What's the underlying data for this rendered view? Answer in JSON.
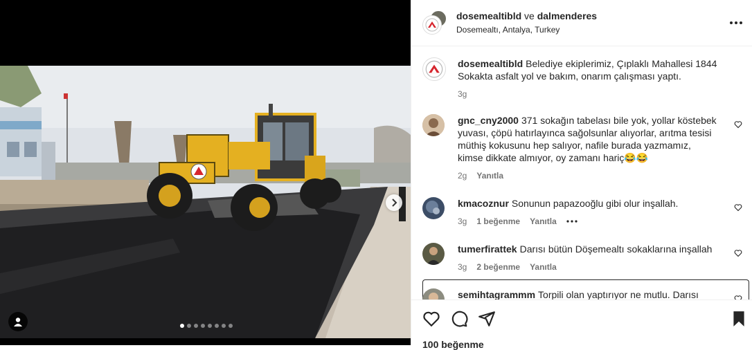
{
  "post": {
    "author": "dosemealtibld",
    "connector": "ve",
    "coauthor": "dalmenderes",
    "location": "Dosemealtı, Antalya, Turkey",
    "more_icon": "more-horizontal-icon"
  },
  "caption": {
    "user": "dosemealtibld",
    "text": "Belediye ekiplerimiz, Çıplaklı Mahallesi 1844 Sokakta asfalt yol ve bakım, onarım çalışması yaptı.",
    "time": "3g"
  },
  "comments": [
    {
      "user": "gnc_cny2000",
      "text": "371 sokağın tabelası bile yok, yollar köstebek yuvası, çöpü hatırlayınca sağolsunlar alıyorlar, arıtma tesisi müthiş kokusunu hep salıyor, nafile burada yazmamız, kimse dikkate almıyor, oy zamanı hariç😂😂",
      "time": "2g",
      "likes": "",
      "reply": "Yanıtla"
    },
    {
      "user": "kmacoznur",
      "text": "Sonunun papazooğlu gibi olur inşallah.",
      "time": "3g",
      "likes": "1 beğenme",
      "reply": "Yanıtla"
    },
    {
      "user": "tumerfirattek",
      "text": "Darısı bütün Döşemealtı sokaklarına inşallah",
      "time": "3g",
      "likes": "2 beğenme",
      "reply": "Yanıtla"
    },
    {
      "user": "semihtagrammm",
      "text": "Torpili olan yaptırıyor ne mutlu. Darısı diğer",
      "time": "",
      "likes": "",
      "reply": ""
    }
  ],
  "actions": {
    "like_icon": "heart-icon",
    "comment_icon": "comment-icon",
    "share_icon": "send-icon",
    "save_icon": "bookmark-icon",
    "likes_count": "100 beğenme"
  },
  "carousel": {
    "slides": 8,
    "active": 0
  },
  "colors": {
    "text": "#262626",
    "secondary": "#737373",
    "logo_red": "#d6262e"
  }
}
